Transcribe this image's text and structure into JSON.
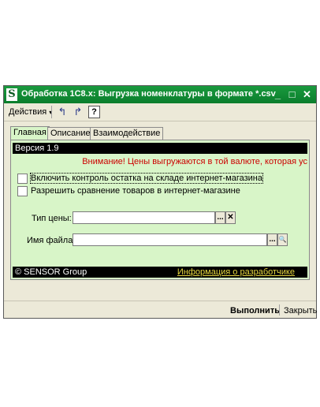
{
  "window": {
    "title": "Обработка  1С8.x: Выгрузка номенклатуры в формате *.csv",
    "minimize_glyph": "_",
    "maximize_glyph": "□",
    "close_glyph": "✕"
  },
  "toolbar": {
    "actions_label": "Действия",
    "actions_arrow": "▾",
    "undo_glyph": "↰",
    "redo_glyph": "↱",
    "help_glyph": "?"
  },
  "tabs": [
    {
      "label": "Главная",
      "active": true
    },
    {
      "label": "Описание",
      "active": false
    },
    {
      "label": "Взаимодействие",
      "active": false
    }
  ],
  "main": {
    "version": "Версия 1.9",
    "warning": "Внимание! Цены выгружаются в той валюте, которая ус",
    "checkboxes": [
      {
        "label": "Включить контроль остатка на складе интернет-магазина",
        "checked": false
      },
      {
        "label": "Разрешить сравнение товаров в интернет-магазине",
        "checked": false
      }
    ],
    "price_type": {
      "label": "Тип цены:",
      "value": "",
      "select_glyph": "...",
      "clear_glyph": "✕"
    },
    "file_name": {
      "label": "Имя файла:",
      "value": "",
      "select_glyph": "...",
      "open_glyph": "🔍"
    },
    "copyright": "© SENSOR Group",
    "developer_link": "Информация о разработчике"
  },
  "footer": {
    "run_label": "Выполнить",
    "close_label": "Закрыть"
  },
  "colors": {
    "titlebar": "#0a7d2c",
    "panel_bg": "#d8f5c8",
    "warning_text": "#cc0000",
    "link_text": "#e8d840"
  }
}
